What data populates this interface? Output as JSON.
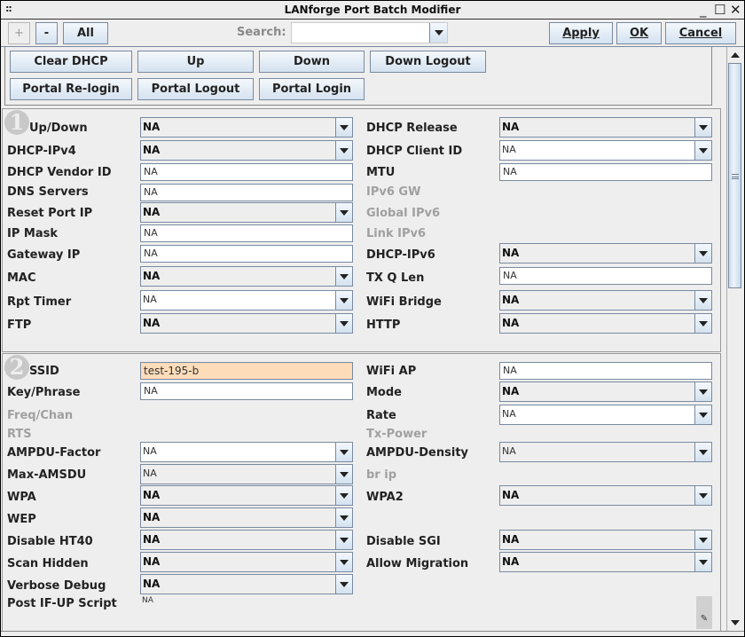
{
  "window": {
    "title": "LANforge Port Batch Modifier",
    "grip": "::",
    "controls": {
      "minimize": "_",
      "maximize": "☐",
      "close": "✕"
    }
  },
  "toolbar": {
    "plus_label": "+",
    "minus_label": "-",
    "all_label": "All",
    "search_label": "Search:",
    "search_value": "",
    "apply_label": "Apply",
    "ok_label": "OK",
    "cancel_label": "Cancel"
  },
  "actions": {
    "row1": [
      "Clear DHCP",
      "Up",
      "Down",
      "Down Logout"
    ],
    "row2": [
      "Portal Re-login",
      "Portal Logout",
      "Portal Login"
    ]
  },
  "section1": {
    "badge": "1",
    "left": [
      {
        "label": "Up/Down",
        "type": "combo",
        "value": "NA"
      },
      {
        "label": "DHCP-IPv4",
        "type": "combo",
        "value": "NA"
      },
      {
        "label": "DHCP Vendor ID",
        "type": "text",
        "value": "NA"
      },
      {
        "label": "DNS Servers",
        "type": "text",
        "value": "NA"
      },
      {
        "label": "Reset Port IP",
        "type": "combo",
        "value": "NA"
      },
      {
        "label": "IP Mask",
        "type": "text",
        "value": "NA"
      },
      {
        "label": "Gateway IP",
        "type": "text",
        "value": "NA"
      },
      {
        "label": "MAC",
        "type": "combo",
        "value": "NA"
      },
      {
        "label": "Rpt Timer",
        "type": "combo-editable",
        "value": "NA"
      },
      {
        "label": "FTP",
        "type": "combo",
        "value": "NA"
      }
    ],
    "right": [
      {
        "label": "DHCP Release",
        "type": "combo",
        "value": "NA"
      },
      {
        "label": "DHCP Client ID",
        "type": "combo-editable",
        "value": "NA"
      },
      {
        "label": "MTU",
        "type": "text",
        "value": "NA"
      },
      {
        "label": "IPv6 GW",
        "type": "disabled"
      },
      {
        "label": "Global IPv6",
        "type": "disabled"
      },
      {
        "label": "Link IPv6",
        "type": "disabled"
      },
      {
        "label": "DHCP-IPv6",
        "type": "combo",
        "value": "NA"
      },
      {
        "label": "TX Q Len",
        "type": "text",
        "value": "NA"
      },
      {
        "label": "WiFi Bridge",
        "type": "combo",
        "value": "NA"
      },
      {
        "label": "HTTP",
        "type": "combo",
        "value": "NA"
      }
    ]
  },
  "section2": {
    "badge": "2",
    "left": [
      {
        "label": "SSID",
        "type": "text-highlight",
        "value": "test-195-b"
      },
      {
        "label": "Key/Phrase",
        "type": "text",
        "value": "NA"
      },
      {
        "label": "Freq/Chan",
        "type": "disabled"
      },
      {
        "label": "RTS",
        "type": "disabled"
      },
      {
        "label": "AMPDU-Factor",
        "type": "combo-light",
        "value": "NA"
      },
      {
        "label": "Max-AMSDU",
        "type": "combo-light",
        "value": "NA"
      },
      {
        "label": "WPA",
        "type": "combo",
        "value": "NA"
      },
      {
        "label": "WEP",
        "type": "combo",
        "value": "NA"
      },
      {
        "label": "Disable HT40",
        "type": "combo",
        "value": "NA"
      },
      {
        "label": "Scan Hidden",
        "type": "combo",
        "value": "NA"
      },
      {
        "label": "Verbose Debug",
        "type": "combo",
        "value": "NA"
      },
      {
        "label": "Post IF-UP Script",
        "type": "plain",
        "value": "NA"
      }
    ],
    "right": [
      {
        "label": "WiFi AP",
        "type": "text",
        "value": "NA"
      },
      {
        "label": "Mode",
        "type": "combo",
        "value": "NA"
      },
      {
        "label": "Rate",
        "type": "combo-editable",
        "value": "NA"
      },
      {
        "label": "Tx-Power",
        "type": "disabled"
      },
      {
        "label": "AMPDU-Density",
        "type": "combo-light",
        "value": "NA"
      },
      {
        "label": "br ip",
        "type": "disabled"
      },
      {
        "label": "WPA2",
        "type": "combo",
        "value": "NA"
      },
      {
        "label": "Disable SGI",
        "type": "combo",
        "value": "NA"
      },
      {
        "label": "Allow Migration",
        "type": "combo",
        "value": "NA"
      }
    ],
    "edit_icon": "✎"
  }
}
